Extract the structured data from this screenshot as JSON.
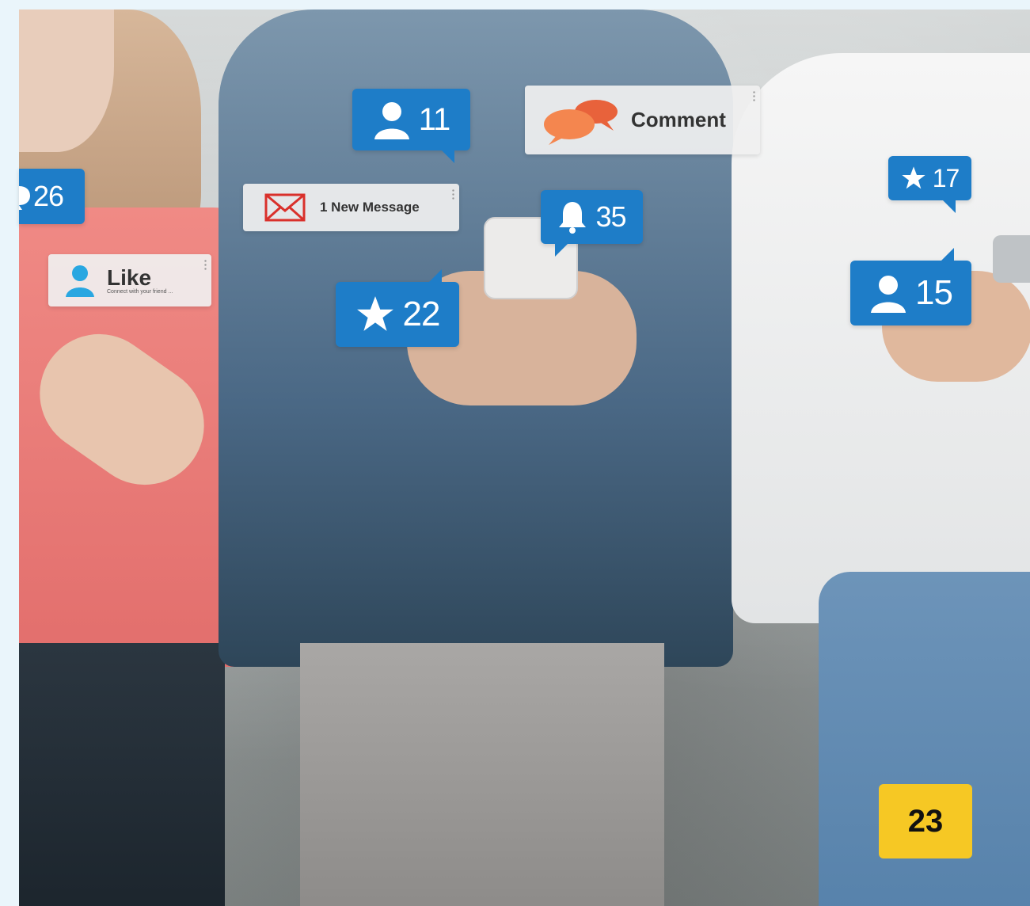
{
  "notifications": {
    "followers_top": {
      "count": "11",
      "icon": "user-icon"
    },
    "comment_card": {
      "label": "Comment",
      "icon": "chat-bubbles-icon"
    },
    "star_right": {
      "count": "17",
      "icon": "star-icon"
    },
    "left_edge": {
      "count": "26",
      "icon": "comment-icon"
    },
    "message_card": {
      "label": "1 New Message",
      "icon": "envelope-icon"
    },
    "bell": {
      "count": "35",
      "icon": "bell-icon"
    },
    "like_card": {
      "label": "Like",
      "sublabel": "Connect with your friend ...",
      "icon": "user-icon"
    },
    "star_mid": {
      "count": "22",
      "icon": "star-icon"
    },
    "followers_right": {
      "count": "15",
      "icon": "user-icon"
    }
  },
  "page_badge": {
    "number": "23"
  },
  "colors": {
    "bubble_blue": "#1e7dc8",
    "comment_orange": "#f07a4a",
    "mail_red": "#d9302b",
    "badge_yellow": "#f6c824"
  }
}
